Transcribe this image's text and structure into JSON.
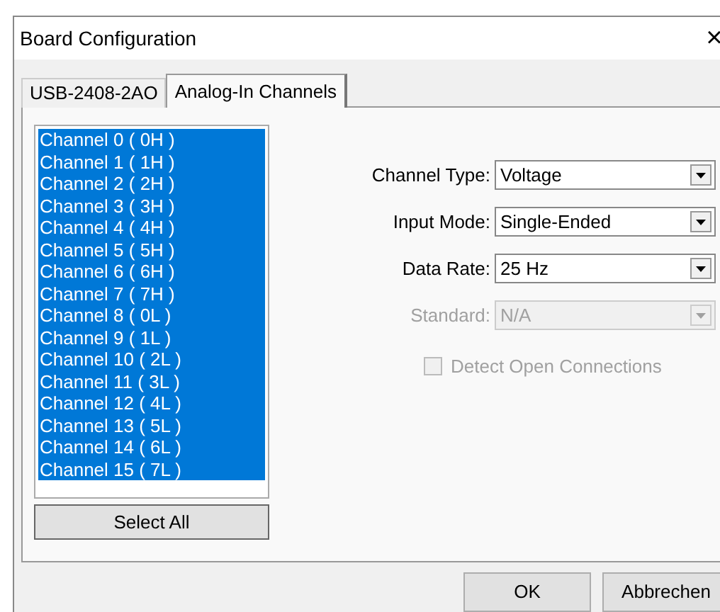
{
  "window": {
    "title": "Board Configuration",
    "close": "×"
  },
  "tabs": [
    {
      "label": "USB-2408-2AO",
      "selected": false
    },
    {
      "label": "Analog-In Channels",
      "selected": true
    }
  ],
  "channels": [
    {
      "label": "Channel 0 ( 0H )",
      "selected": true
    },
    {
      "label": "Channel 1 ( 1H )",
      "selected": true
    },
    {
      "label": "Channel 2 ( 2H )",
      "selected": true
    },
    {
      "label": "Channel 3 ( 3H )",
      "selected": true
    },
    {
      "label": "Channel 4 ( 4H )",
      "selected": true
    },
    {
      "label": "Channel 5 ( 5H )",
      "selected": true
    },
    {
      "label": "Channel 6 ( 6H )",
      "selected": true
    },
    {
      "label": "Channel 7 ( 7H )",
      "selected": true
    },
    {
      "label": "Channel 8 ( 0L )",
      "selected": true
    },
    {
      "label": "Channel 9 ( 1L )",
      "selected": true
    },
    {
      "label": "Channel 10 ( 2L )",
      "selected": true
    },
    {
      "label": "Channel 11 ( 3L )",
      "selected": true
    },
    {
      "label": "Channel 12 ( 4L )",
      "selected": true
    },
    {
      "label": "Channel 13 ( 5L )",
      "selected": true
    },
    {
      "label": "Channel 14 ( 6L )",
      "selected": true
    },
    {
      "label": "Channel 15 ( 7L )",
      "selected": true
    }
  ],
  "select_all_button": "Select All",
  "settings": [
    {
      "label": "Channel Type:",
      "value": "Voltage",
      "disabled": false
    },
    {
      "label": "Input Mode:",
      "value": "Single-Ended",
      "disabled": false
    },
    {
      "label": "Data Rate:",
      "value": "25 Hz",
      "disabled": false
    },
    {
      "label": "Standard:",
      "value": "N/A",
      "disabled": true
    }
  ],
  "detect_open_connections": {
    "label": "Detect Open Connections",
    "checked": false,
    "disabled": true
  },
  "buttons": [
    "OK",
    "Abbrechen"
  ]
}
